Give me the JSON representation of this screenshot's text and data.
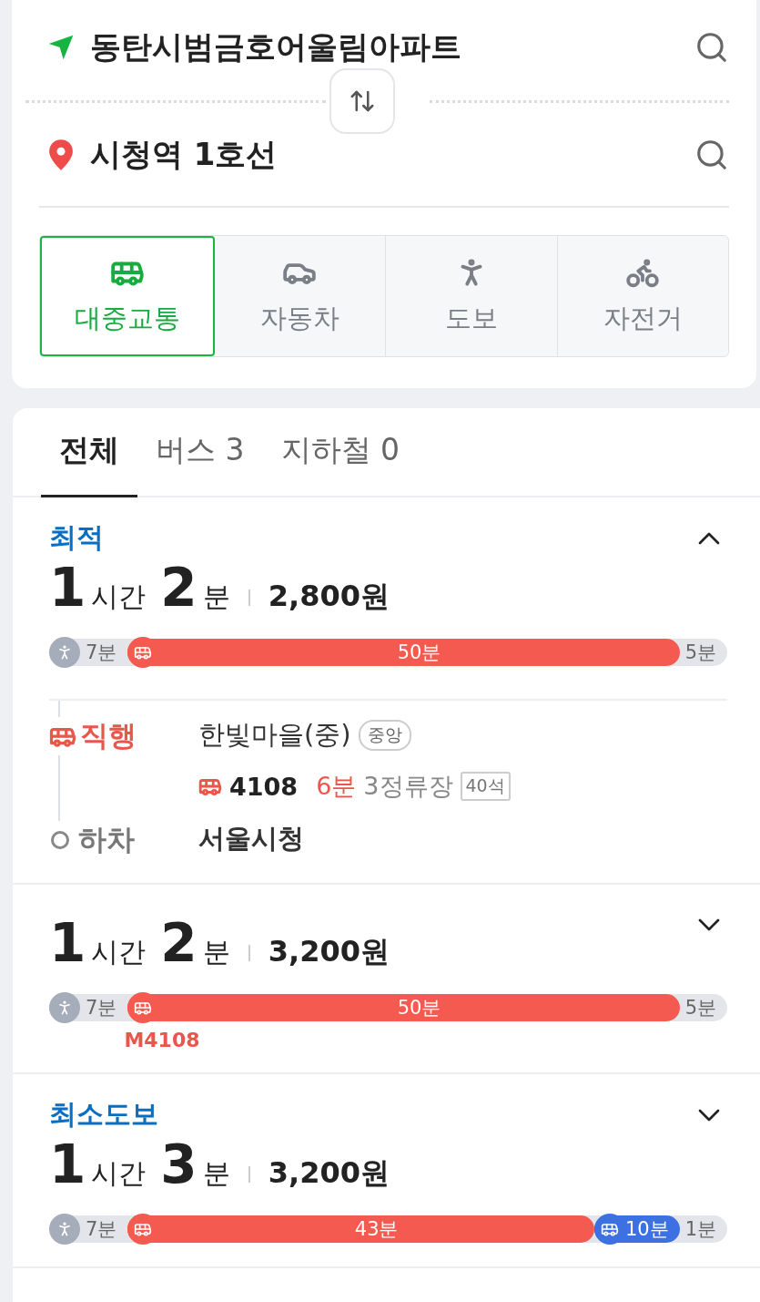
{
  "search": {
    "origin": "동탄시범금호어울림아파트",
    "destination": "시청역 1호선"
  },
  "modes": [
    {
      "kind": "bus",
      "label": "대중교통",
      "selected": true
    },
    {
      "kind": "car",
      "label": "자동차",
      "selected": false
    },
    {
      "kind": "walk",
      "label": "도보",
      "selected": false
    },
    {
      "kind": "bike",
      "label": "자전거",
      "selected": false
    }
  ],
  "tabs": [
    {
      "label": "전체",
      "selected": true
    },
    {
      "label": "버스 3",
      "selected": false
    },
    {
      "label": "지하철 0",
      "selected": false
    }
  ],
  "routes": [
    {
      "tag": "최적",
      "expanded": true,
      "hours": "1",
      "hours_unit": "시간",
      "minutes": "2",
      "minutes_unit": "분",
      "fare": "2,800원",
      "segments": [
        {
          "kind": "walk",
          "label": "7분"
        },
        {
          "kind": "bus",
          "label": "50분"
        },
        {
          "kind": "walk",
          "label": "5분"
        }
      ],
      "steps": [
        {
          "kind": "board",
          "label": "직행",
          "stop": "한빛마을(중)",
          "stop_badge": "중앙",
          "bus_number": "4108",
          "wait": "6분",
          "stops": "3정류장",
          "seats": "40석"
        },
        {
          "kind": "alight",
          "label": "하차",
          "stop": "서울시청"
        }
      ]
    },
    {
      "expanded": false,
      "hours": "1",
      "hours_unit": "시간",
      "minutes": "2",
      "minutes_unit": "분",
      "fare": "3,200원",
      "segments": [
        {
          "kind": "walk",
          "label": "7분"
        },
        {
          "kind": "bus",
          "label": "50분",
          "caption": "M4108"
        },
        {
          "kind": "walk",
          "label": "5분"
        }
      ]
    },
    {
      "tag": "최소도보",
      "expanded": false,
      "hours": "1",
      "hours_unit": "시간",
      "minutes": "3",
      "minutes_unit": "분",
      "fare": "3,200원",
      "segments": [
        {
          "kind": "walk",
          "label": "7분"
        },
        {
          "kind": "bus",
          "label": "43분"
        },
        {
          "kind": "express",
          "label": "10분"
        },
        {
          "kind": "walk",
          "label": "1분"
        }
      ]
    }
  ]
}
